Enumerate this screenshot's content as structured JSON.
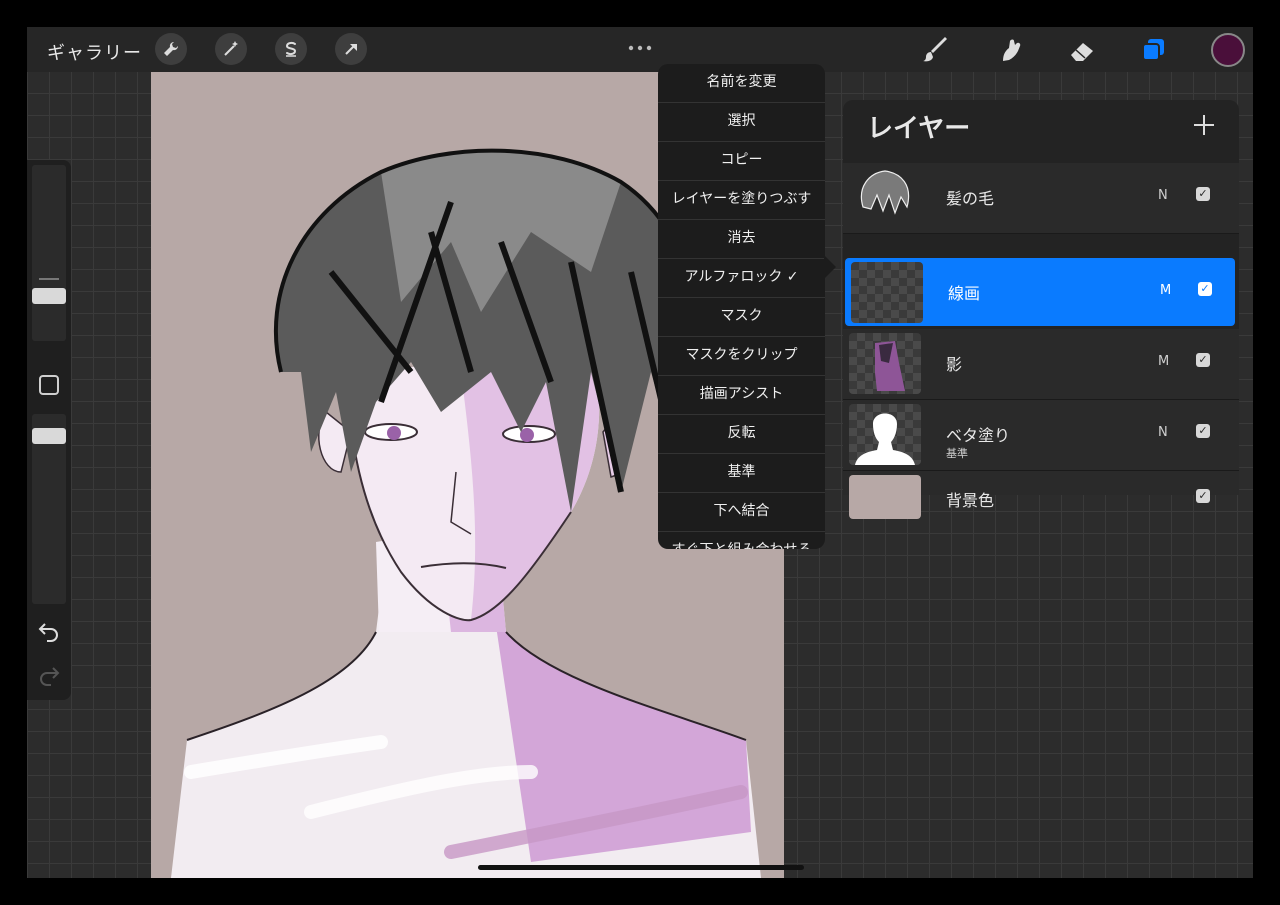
{
  "toolbar": {
    "gallery_label": "ギャラリー",
    "left_tools": [
      {
        "name": "wrench-icon"
      },
      {
        "name": "magic-wand-icon"
      },
      {
        "name": "selection-icon"
      },
      {
        "name": "transform-arrow-icon"
      }
    ],
    "more_dots": "•••",
    "right_tools": [
      {
        "name": "brush-icon"
      },
      {
        "name": "smudge-icon"
      },
      {
        "name": "eraser-icon"
      },
      {
        "name": "layers-icon",
        "active_color": "#0a7bff"
      }
    ],
    "current_color": "#4a0f3a"
  },
  "layer_menu": {
    "items": [
      "名前を変更",
      "選択",
      "コピー",
      "レイヤーを塗りつぶす",
      "消去",
      "アルファロック ✓",
      "マスク",
      "マスクをクリップ",
      "描画アシスト",
      "反転",
      "基準",
      "下へ結合",
      "すぐ下と組み合わせる"
    ]
  },
  "layers_panel": {
    "title": "レイヤー",
    "add_icon": "plus-icon",
    "layers": [
      {
        "name": "髪の毛",
        "sub": "",
        "mode": "N",
        "visible": "✓",
        "active": false,
        "thumb": "hair"
      },
      {
        "name": "線画",
        "sub": "",
        "mode": "M",
        "visible": "✓",
        "active": true,
        "thumb": "empty"
      },
      {
        "name": "影",
        "sub": "",
        "mode": "M",
        "visible": "✓",
        "active": false,
        "thumb": "shadow"
      },
      {
        "name": "ベタ塗り",
        "sub": "基準",
        "mode": "N",
        "visible": "✓",
        "active": false,
        "thumb": "silhouette"
      },
      {
        "name": "背景色",
        "sub": "",
        "mode": "",
        "visible": "✓",
        "active": false,
        "thumb": "background"
      }
    ]
  },
  "colors": {
    "accent": "#0a7bff",
    "canvas_background": "#b7a8a6",
    "skin_shadow": "#d3a6d8"
  }
}
